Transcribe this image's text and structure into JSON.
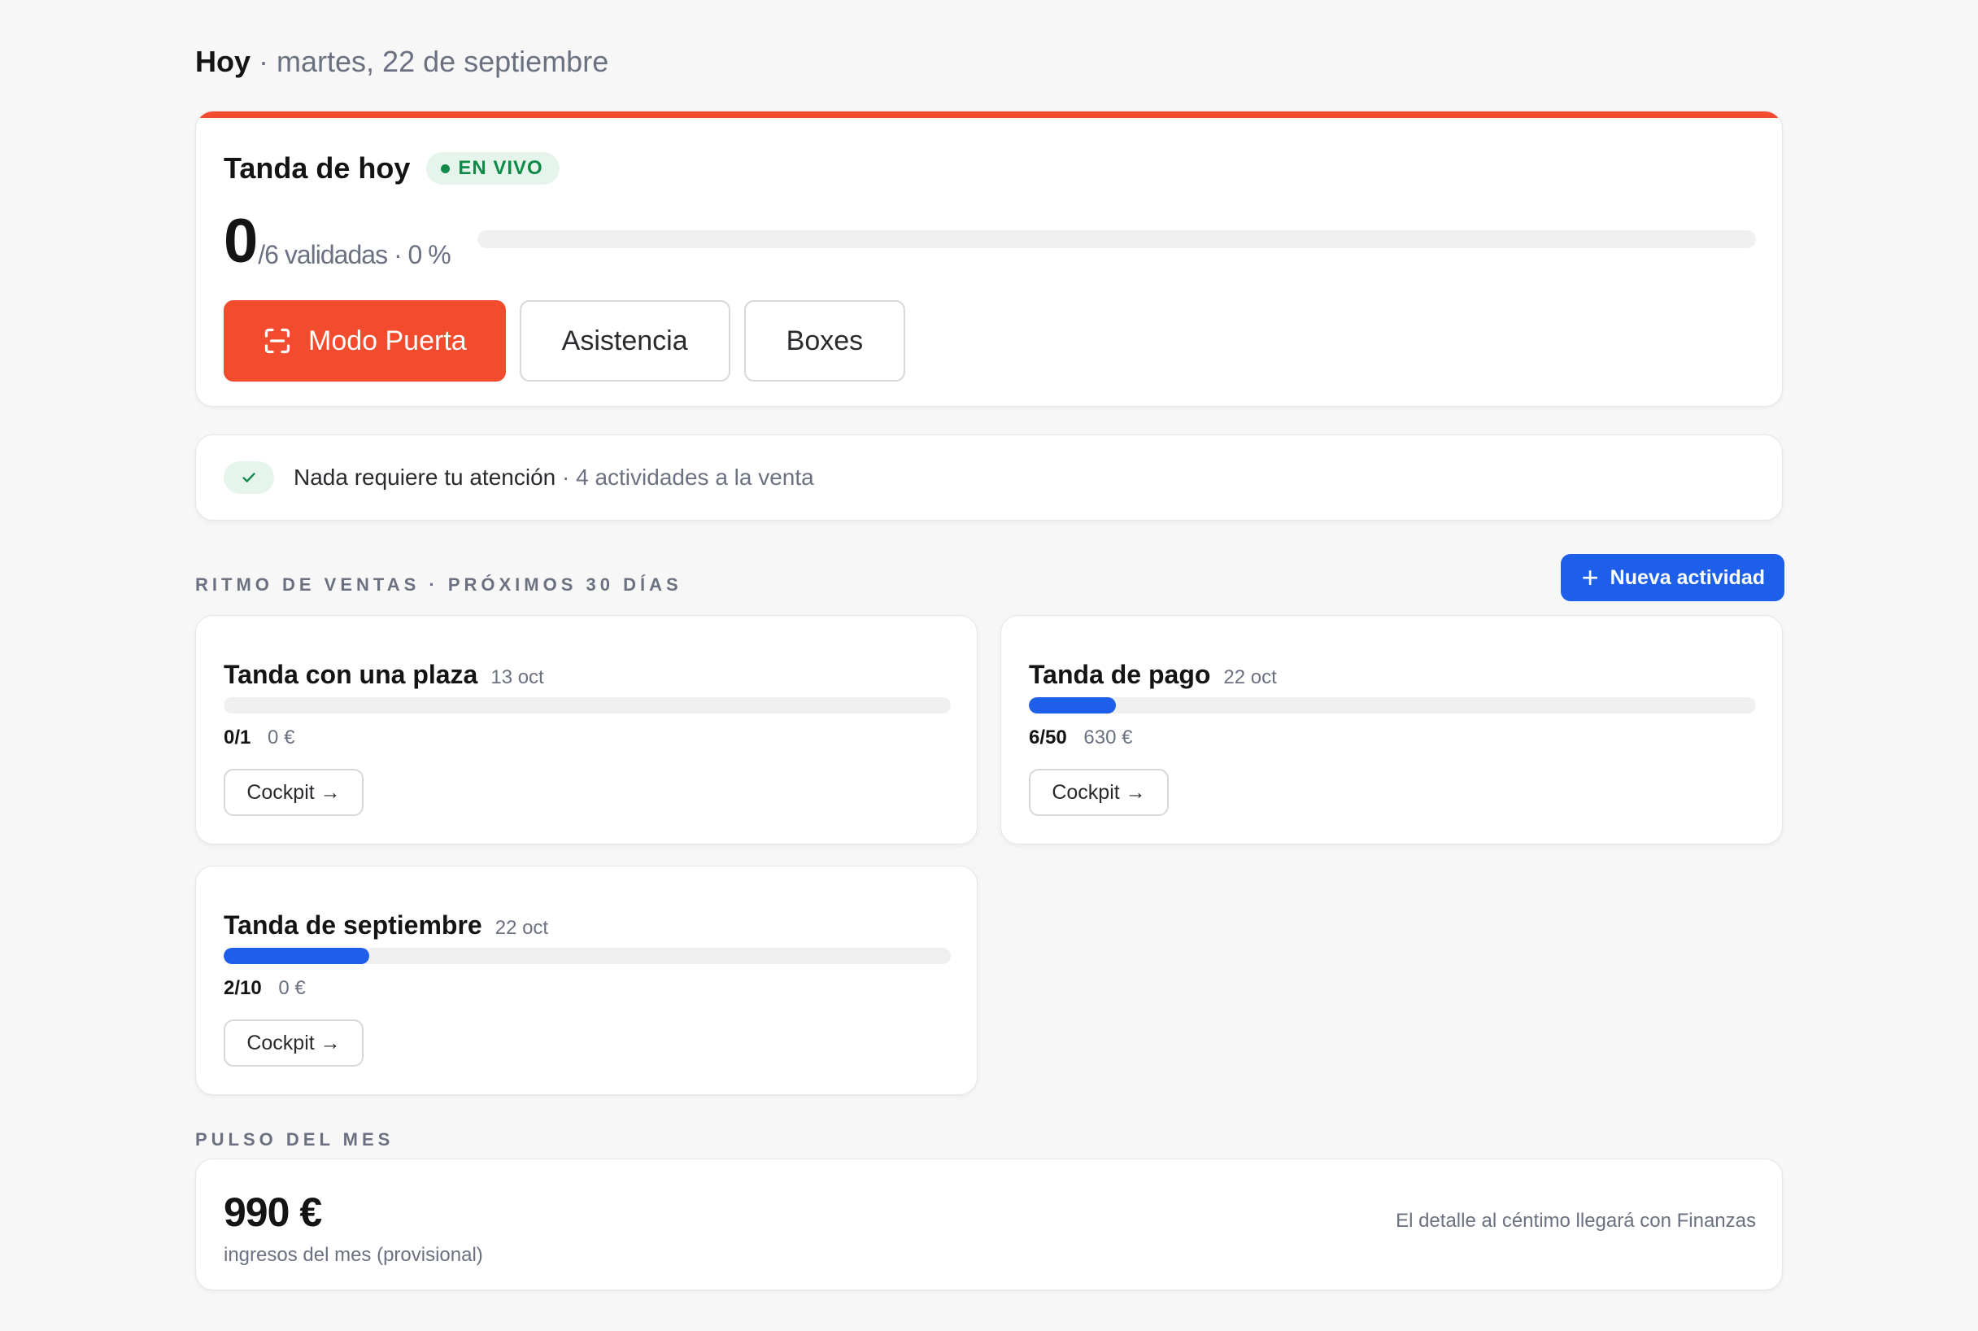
{
  "header": {
    "title": "Hoy",
    "separator": " · ",
    "date": "martes, 22 de septiembre"
  },
  "today": {
    "title": "Tanda de hoy",
    "live_badge": "EN VIVO",
    "validated": "0",
    "stats_suffix": "/6 validadas · 0 %",
    "progress_fraction": 0,
    "buttons": {
      "door_mode": "Modo Puerta",
      "attendance": "Asistencia",
      "boxes": "Boxes"
    }
  },
  "attention": {
    "main": "Nada requiere tu atención",
    "secondary": " · 4 actividades a la venta"
  },
  "sales": {
    "section_label": "RITMO DE VENTAS · PRÓXIMOS 30 DÍAS",
    "new_activity_label": "Nueva actividad",
    "cockpit_label": "Cockpit →",
    "activities": [
      {
        "name": "Tanda con una plaza",
        "date": "13 oct",
        "count": "0/1",
        "money": "0 €",
        "progress_fraction": 0
      },
      {
        "name": "Tanda de pago",
        "date": "22 oct",
        "count": "6/50",
        "money": "630 €",
        "progress_fraction": 0.12
      },
      {
        "name": "Tanda de septiembre",
        "date": "22 oct",
        "count": "2/10",
        "money": "0 €",
        "progress_fraction": 0.2
      }
    ]
  },
  "pulse": {
    "section_label": "PULSO DEL MES",
    "amount": "990 €",
    "subtitle": "ingresos del mes (provisional)",
    "note": "El detalle al céntimo llegará con Finanzas"
  },
  "colors": {
    "accent": "#f24b2e",
    "primary_blue": "#1d5fe8",
    "success": "#0f8a49"
  }
}
